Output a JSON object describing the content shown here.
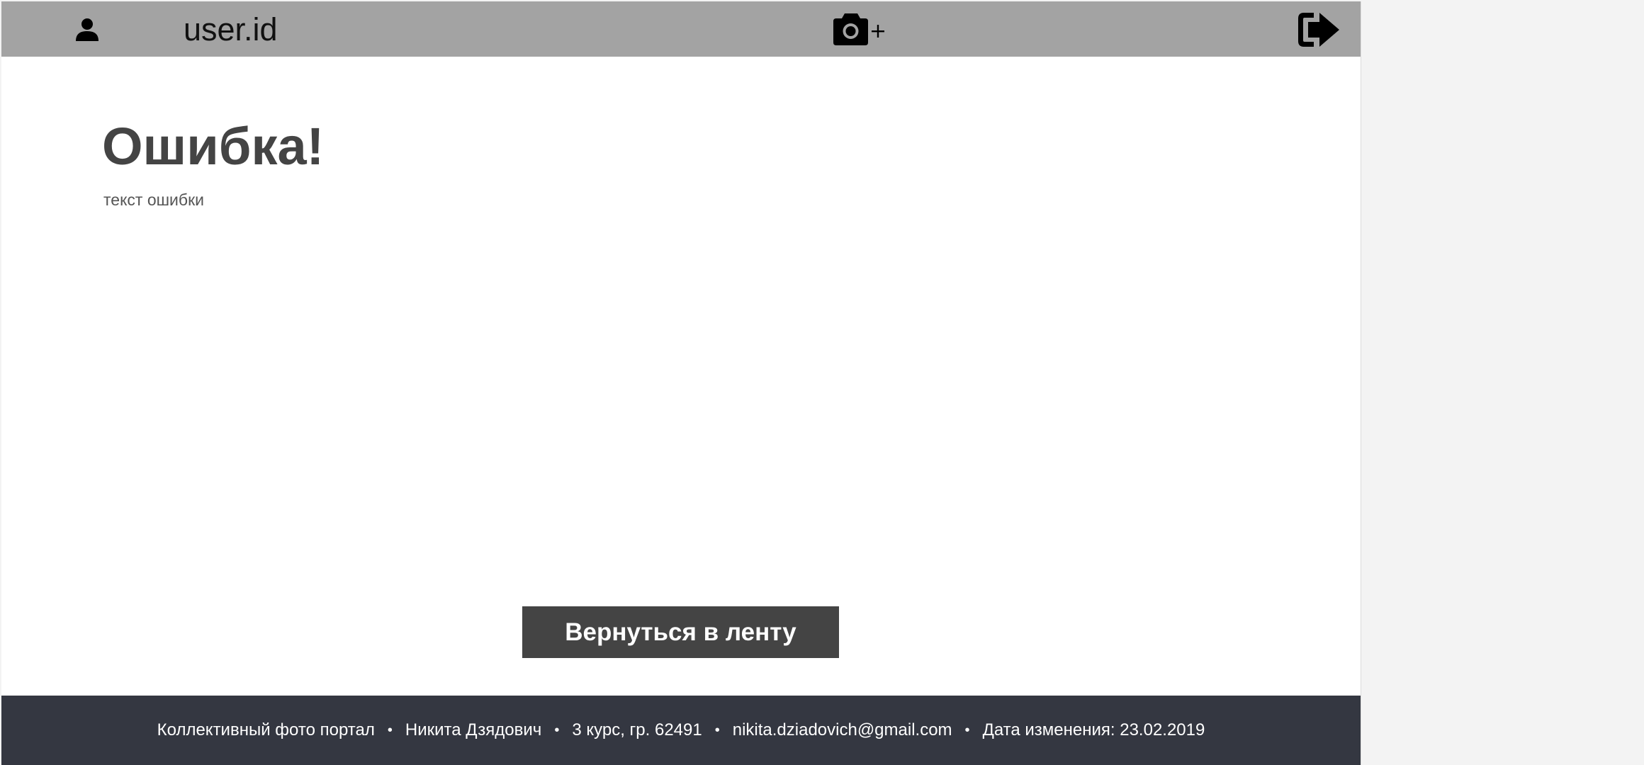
{
  "header": {
    "username": "user.id",
    "icons": {
      "user": "user-icon",
      "add_photo": "camera-plus-icon",
      "logout": "logout-icon"
    },
    "background_color": "#a3a3a3"
  },
  "error": {
    "title": "Ошибка!",
    "text": "текст ошибки"
  },
  "back_button": {
    "label": "Вернуться в ленту",
    "background_color": "#444444"
  },
  "footer": {
    "background_color": "#343741",
    "items": [
      "Коллективный фото портал",
      "Никита Дзядович",
      "3 курс, гр. 62491",
      "nikita.dziadovich@gmail.com",
      "Дата изменения: 23.02.2019"
    ],
    "separator": "•"
  }
}
